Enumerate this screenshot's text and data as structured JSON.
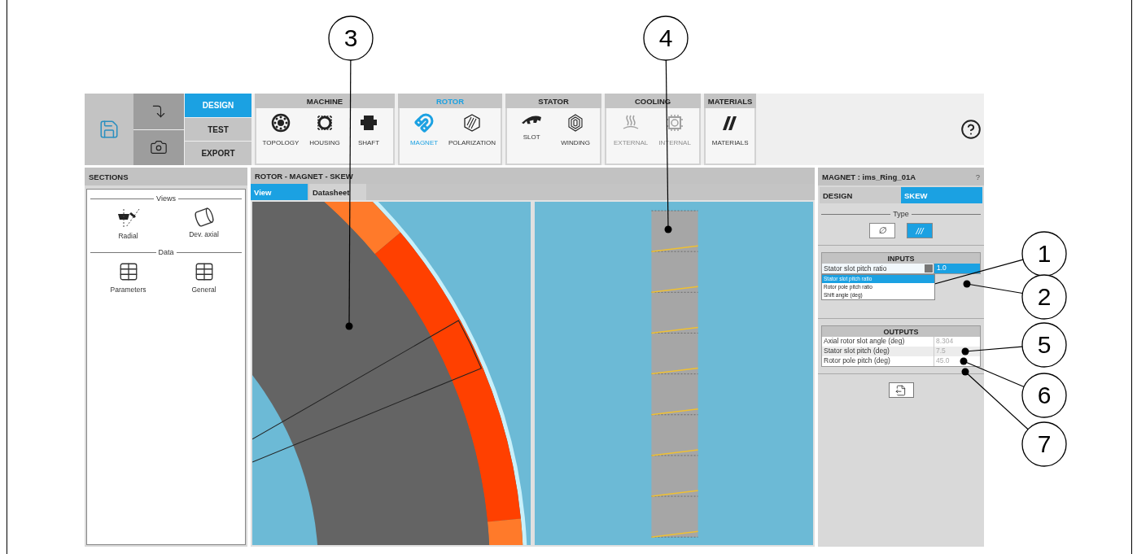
{
  "mode_tabs": [
    {
      "label": "DESIGN",
      "selected": true
    },
    {
      "label": "TEST",
      "selected": false
    },
    {
      "label": "EXPORT",
      "selected": false
    }
  ],
  "ribbon_groups": [
    {
      "title": "MACHINE",
      "selected": false,
      "items": [
        {
          "label": "TOPOLOGY",
          "kind": "topology",
          "selected": false,
          "disabled": false
        },
        {
          "label": "HOUSING",
          "kind": "housing",
          "selected": false,
          "disabled": false
        },
        {
          "label": "SHAFT",
          "kind": "shaft",
          "selected": false,
          "disabled": false
        }
      ]
    },
    {
      "title": "ROTOR",
      "selected": true,
      "items": [
        {
          "label": "MAGNET",
          "kind": "magnet",
          "selected": true,
          "disabled": false
        },
        {
          "label": "POLARIZATION",
          "kind": "polarization",
          "selected": false,
          "disabled": false
        }
      ]
    },
    {
      "title": "STATOR",
      "selected": false,
      "items": [
        {
          "label": "SLOT",
          "kind": "slot",
          "selected": false,
          "disabled": false
        },
        {
          "label": "WINDING",
          "kind": "winding",
          "selected": false,
          "disabled": false
        }
      ]
    },
    {
      "title": "COOLING",
      "selected": false,
      "items": [
        {
          "label": "EXTERNAL",
          "kind": "external",
          "selected": false,
          "disabled": true
        },
        {
          "label": "INTERNAL",
          "kind": "internal",
          "selected": false,
          "disabled": true
        }
      ]
    },
    {
      "title": "MATERIALS",
      "selected": false,
      "items": [
        {
          "label": "MATERIALS",
          "kind": "materials",
          "selected": false,
          "disabled": false
        }
      ]
    }
  ],
  "sections": {
    "title": "SECTIONS",
    "groups": [
      {
        "title": "Views",
        "items": [
          {
            "label": "Radial",
            "kind": "radial"
          },
          {
            "label": "Dev. axial",
            "kind": "axial"
          }
        ]
      },
      {
        "title": "Data",
        "items": [
          {
            "label": "Parameters",
            "kind": "table"
          },
          {
            "label": "General",
            "kind": "table"
          }
        ]
      }
    ]
  },
  "view": {
    "title": "ROTOR - MAGNET - SKEW",
    "tabs": [
      {
        "label": "View",
        "selected": true
      },
      {
        "label": "Datasheet",
        "selected": false
      }
    ]
  },
  "properties": {
    "title": "MAGNET : ims_Ring_01A",
    "help": "?",
    "tabs": [
      {
        "label": "DESIGN",
        "selected": false
      },
      {
        "label": "SKEW",
        "selected": true
      }
    ],
    "type_legend": "Type",
    "type_options": [
      {
        "label": "∅",
        "selected": false
      },
      {
        "label": "///",
        "selected": true
      }
    ],
    "inputs": {
      "title": "INPUTS",
      "parameter": "Stator slot pitch ratio",
      "value": "1.0",
      "expanded": true,
      "options": [
        {
          "label": "Stator slot pitch ratio",
          "selected": true
        },
        {
          "label": "Rotor pole pitch ratio",
          "selected": false
        },
        {
          "label": "Shift angle (deg)",
          "selected": false
        }
      ]
    },
    "outputs": {
      "title": "OUTPUTS",
      "rows": [
        {
          "label": "Axial rotor slot angle (deg)",
          "value": "8.304"
        },
        {
          "label": "Stator slot pitch (deg)",
          "value": "7.5"
        },
        {
          "label": "Rotor pole pitch (deg)",
          "value": "45.0"
        }
      ]
    }
  },
  "callouts": [
    {
      "label": "3"
    },
    {
      "label": "4"
    },
    {
      "label": "1"
    },
    {
      "label": "2"
    },
    {
      "label": "5"
    },
    {
      "label": "6"
    },
    {
      "label": "7"
    }
  ]
}
